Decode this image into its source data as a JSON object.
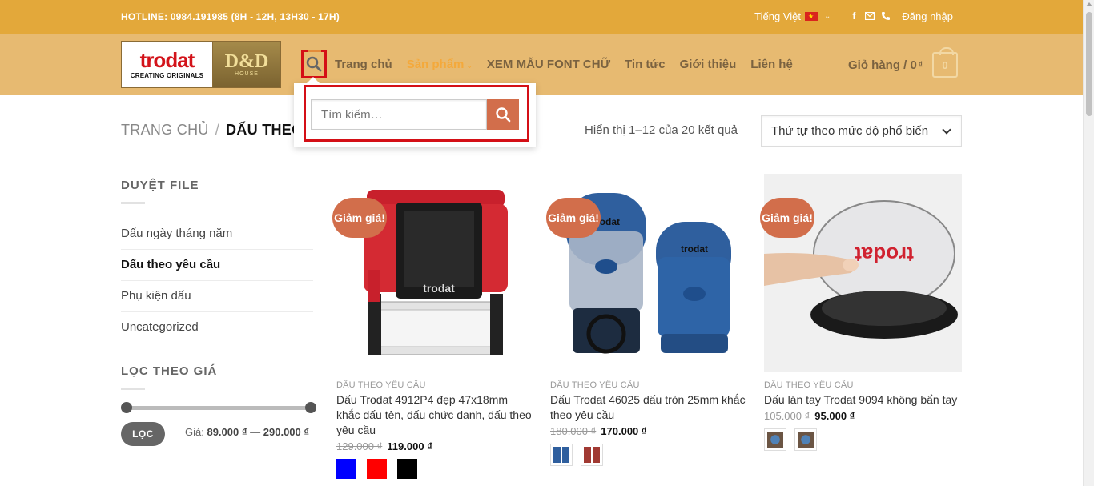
{
  "topbar": {
    "hotline": "HOTLINE: 0984.191985 (8H - 12H, 13H30 - 17H)",
    "language": "Tiếng Việt",
    "login": "Đăng nhập"
  },
  "header": {
    "logo_brand": "trodat",
    "logo_tag": "CREATING ORIGINALS",
    "logo_partner": "D&D",
    "logo_partner_sub": "HOUSE",
    "nav": [
      "Trang chủ",
      "Sản phẩm",
      "XEM MẪU FONT CHỮ",
      "Tin tức",
      "Giới thiệu",
      "Liên hệ"
    ],
    "cart_label": "Giỏ hàng / 0",
    "cart_currency": "₫",
    "cart_count": "0"
  },
  "search": {
    "placeholder": "Tìm kiếm…"
  },
  "breadcrumb": {
    "home": "TRANG CHỦ",
    "separator": "/",
    "current": "DẤU THEO"
  },
  "shop": {
    "result_count": "Hiển thị 1–12 của 20 kết quả",
    "orderby": "Thứ tự theo mức độ phổ biến"
  },
  "sidebar": {
    "browse_title": "DUYỆT FILE",
    "categories": [
      "Dấu ngày tháng năm",
      "Dấu theo yêu cầu",
      "Phụ kiện dấu",
      "Uncategorized"
    ],
    "filter_title": "LỌC THEO GIÁ",
    "filter_button": "LỌC",
    "price_label": "Giá:",
    "price_min": "89.000 ₫",
    "price_dash": "—",
    "price_max": "290.000 ₫"
  },
  "products": [
    {
      "badge": "Giảm giá!",
      "category": "DẤU THEO YÊU CẦU",
      "name": "Dấu Trodat 4912P4 đẹp 47x18mm khắc dấu tên, dấu chức danh, dấu theo yêu cầu",
      "old_price": "129.000 ₫",
      "new_price": "119.000 ₫"
    },
    {
      "badge": "Giảm giá!",
      "category": "DẤU THEO YÊU CẦU",
      "name": "Dấu Trodat 46025 dấu tròn 25mm khắc theo yêu cầu",
      "old_price": "180.000 ₫",
      "new_price": "170.000 ₫"
    },
    {
      "badge": "Giảm giá!",
      "category": "DẤU THEO YÊU CẦU",
      "name": "Dấu lăn tay Trodat 9094 không bẩn tay",
      "old_price": "105.000 ₫",
      "new_price": "95.000 ₫"
    }
  ],
  "colors": {
    "topbar": "#e3a83a",
    "header": "#e7ba71",
    "accent": "#d26e4b",
    "highlight": "#d40f16"
  }
}
